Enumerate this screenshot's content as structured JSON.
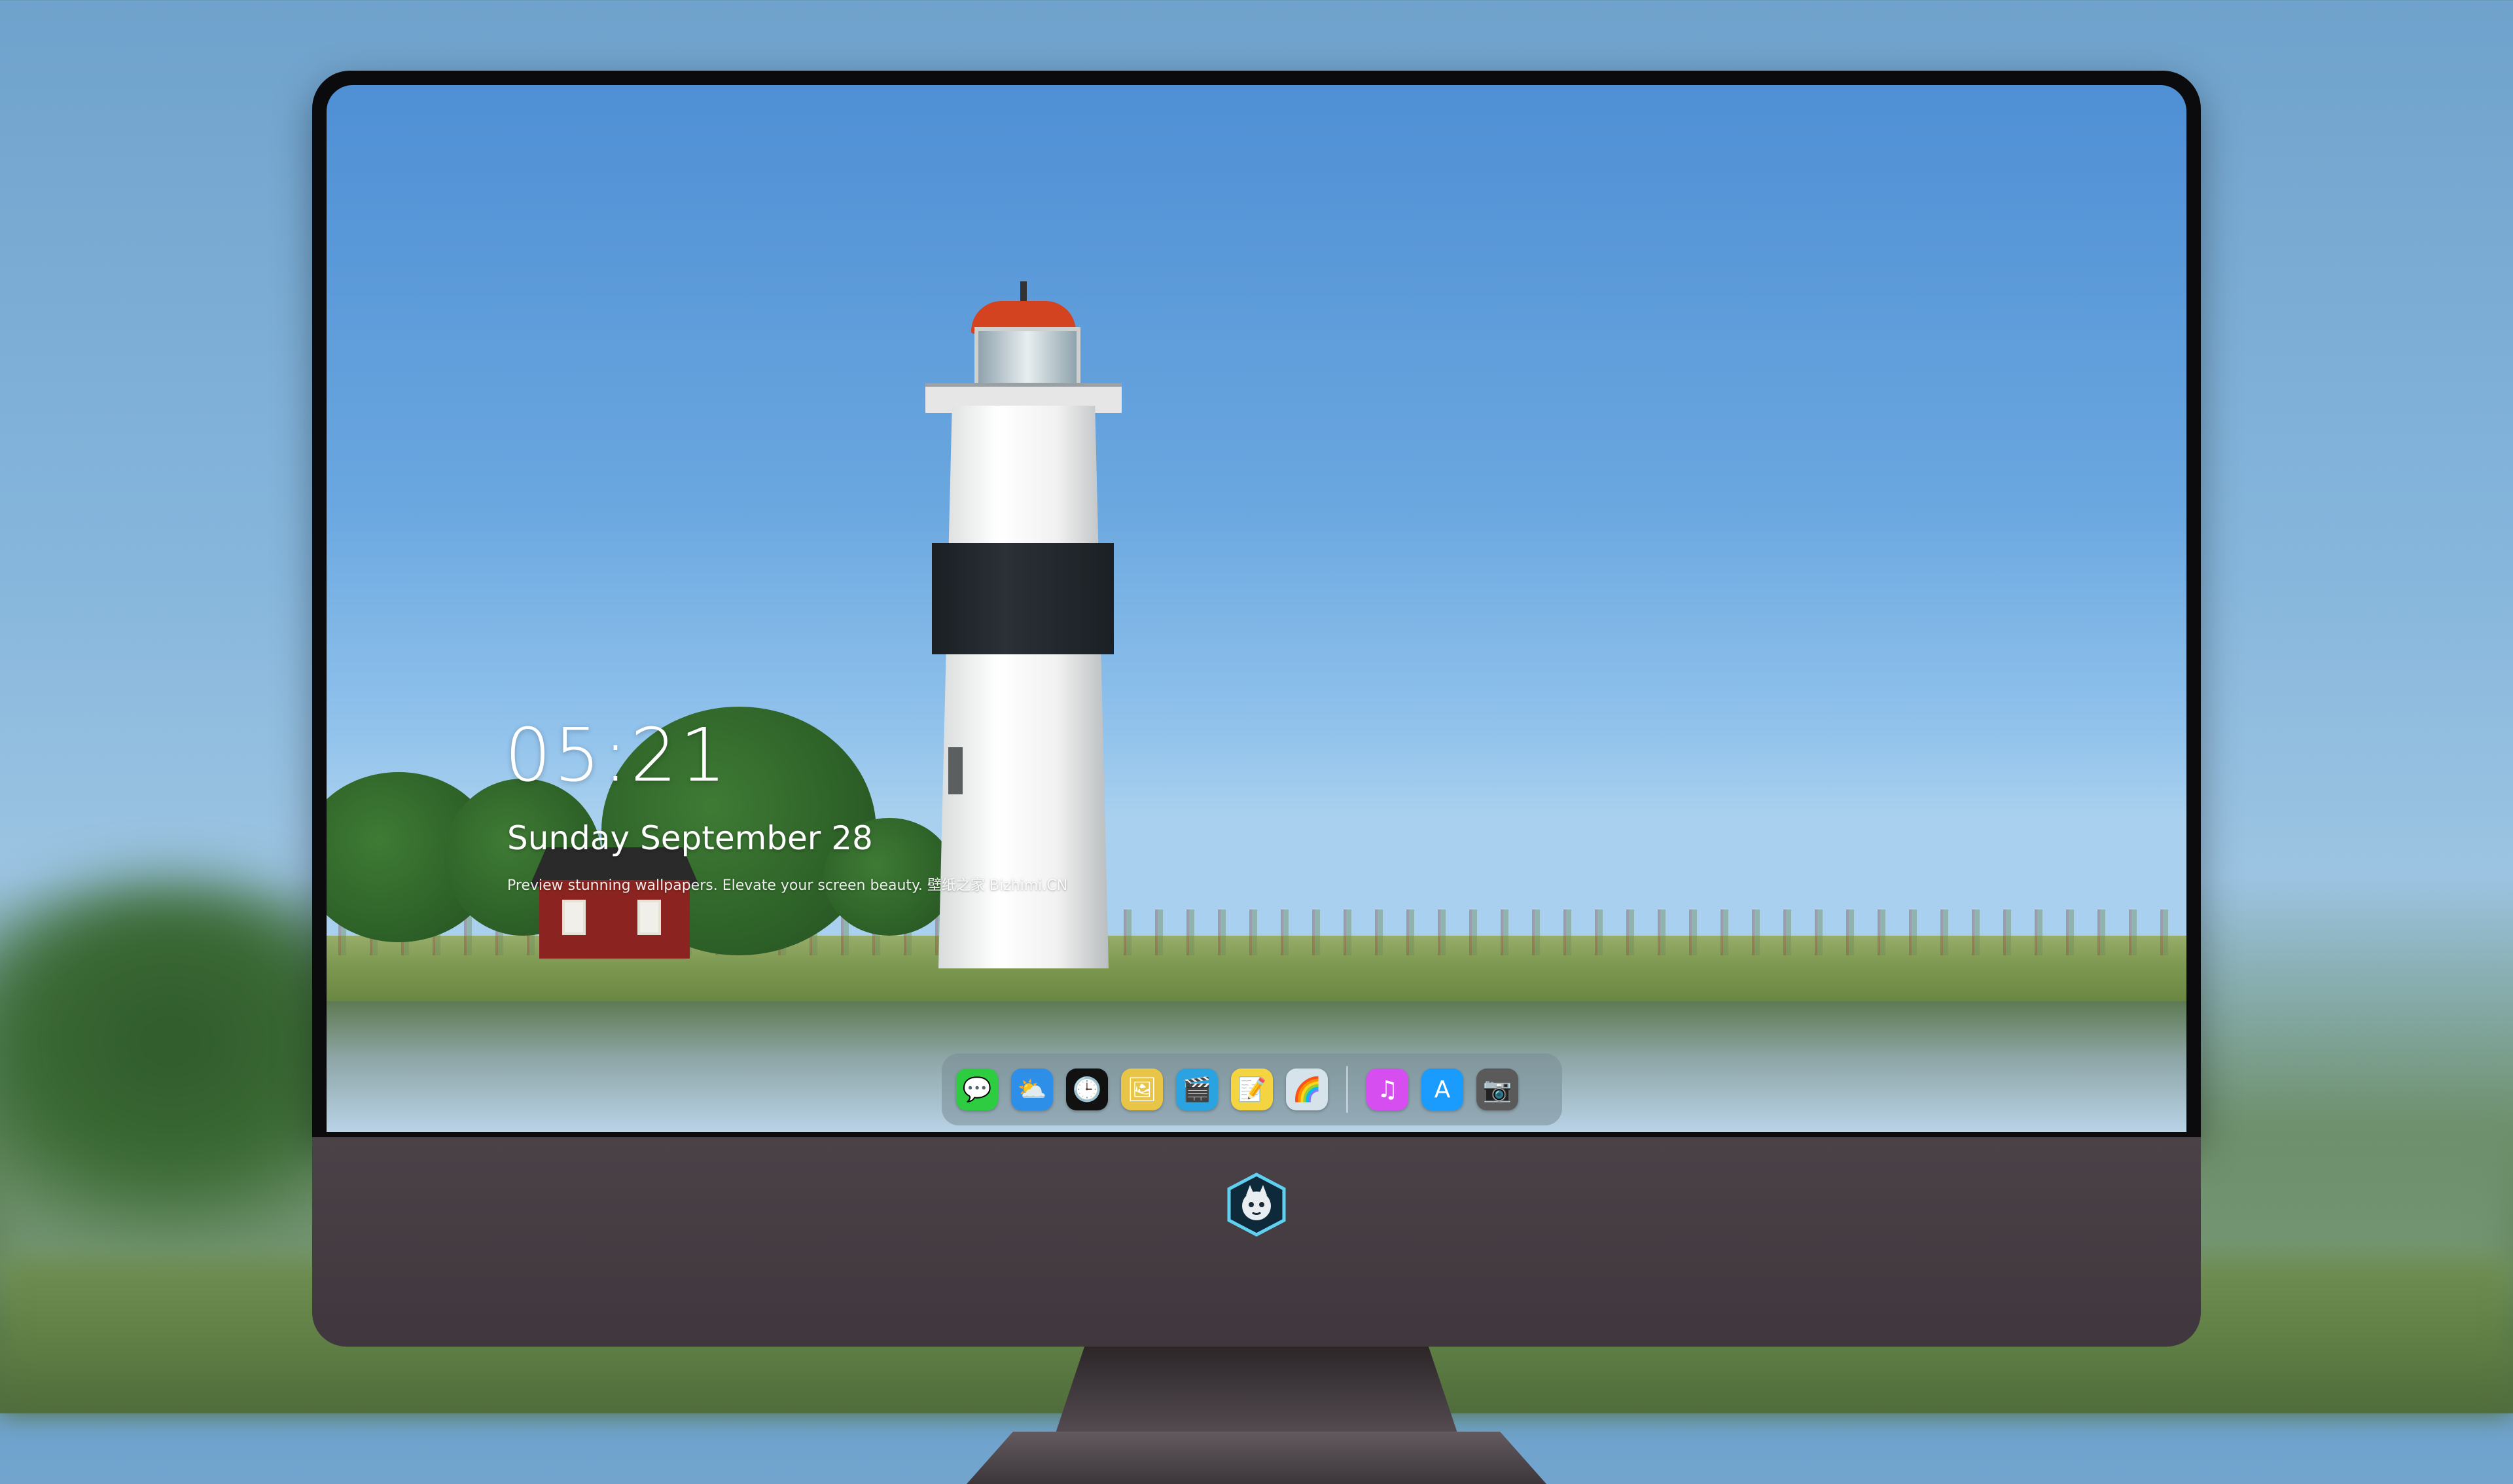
{
  "lockscreen": {
    "time": "05:21",
    "date": "Sunday September 28",
    "tagline": "Preview stunning wallpapers. Elevate your screen beauty. 壁纸之家 Bizhimi.CN"
  },
  "dock": {
    "apps": [
      {
        "name": "Messages",
        "icon": "💬",
        "color": "#2ecc40"
      },
      {
        "name": "Weather",
        "icon": "⛅",
        "color": "#2e8fe8"
      },
      {
        "name": "Clock",
        "icon": "🕒",
        "color": "#111111"
      },
      {
        "name": "Preview",
        "icon": "🖼",
        "color": "#e8c547"
      },
      {
        "name": "Final Cut",
        "icon": "🎬",
        "color": "#2aa3e0"
      },
      {
        "name": "Notes",
        "icon": "📝",
        "color": "#f5d442"
      },
      {
        "name": "Photos",
        "icon": "🌈",
        "color": "#d7e3ea"
      },
      {
        "name": "iTunes",
        "icon": "♫",
        "color": "#d64df0"
      },
      {
        "name": "App Store",
        "icon": "A",
        "color": "#1a9cff"
      },
      {
        "name": "Camera",
        "icon": "📷",
        "color": "#5a5a5a"
      }
    ]
  },
  "monitor": {
    "chin_logo": "bizhimi-logo"
  },
  "colors": {
    "sky_top": "#4f8fd4",
    "bezel": "#0b0b0d",
    "chin": "#4a4247"
  }
}
